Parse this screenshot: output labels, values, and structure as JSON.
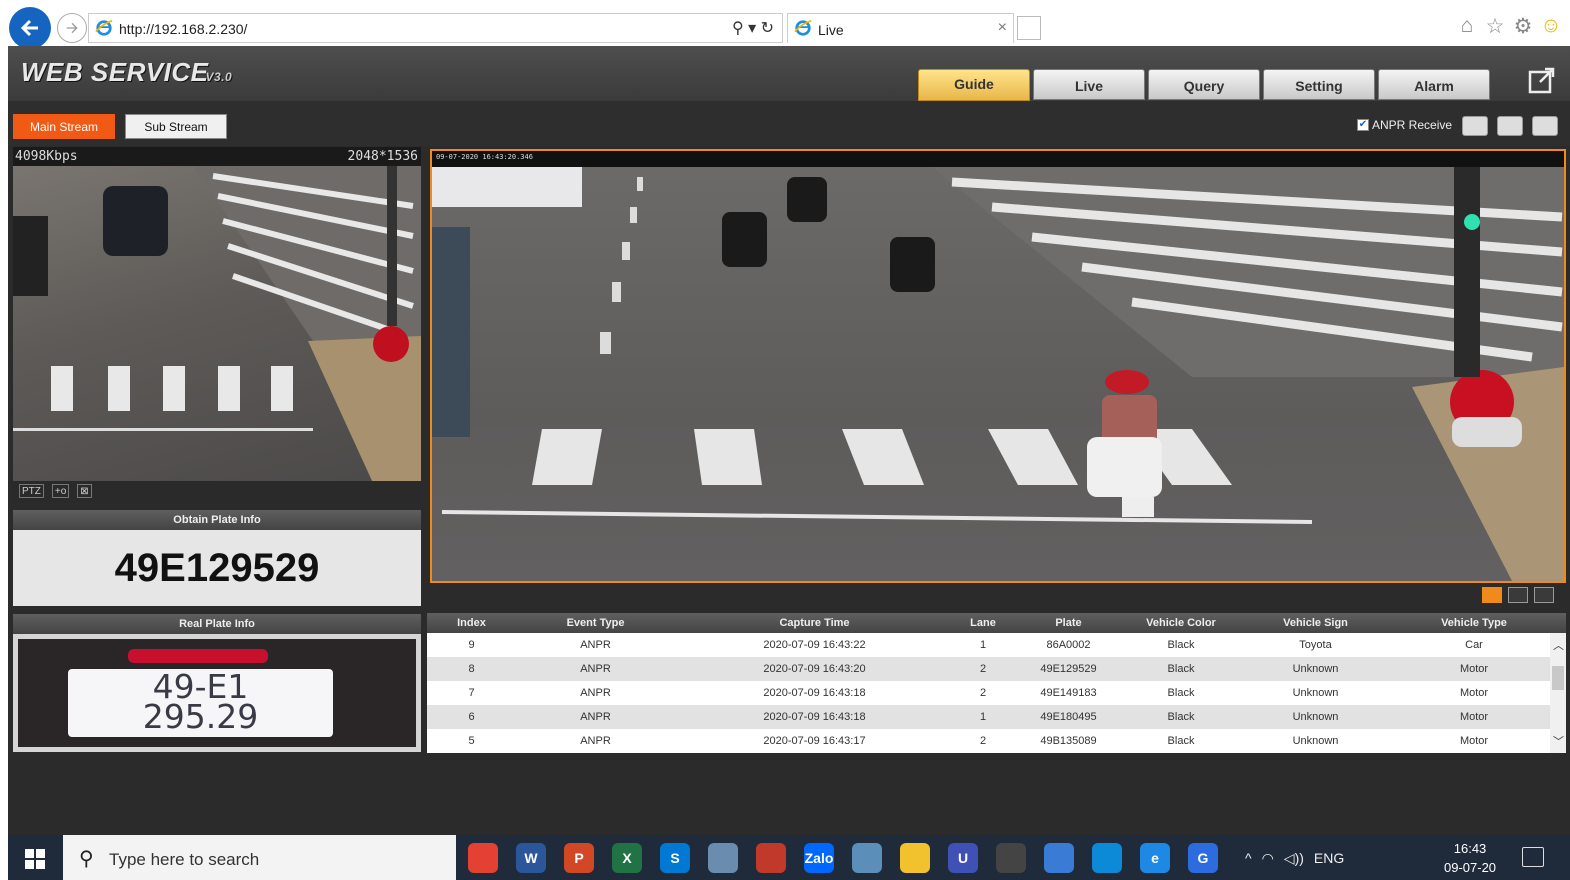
{
  "browser": {
    "url": "http://192.168.2.230/",
    "tab_title": "Live",
    "address_actions": "⚲ ▾ ↻",
    "tab_close": "×"
  },
  "app": {
    "logo": "WEB  SERVICE",
    "version": "V3.0",
    "tabs": [
      {
        "label": "Guide",
        "active": true
      },
      {
        "label": "Live",
        "active": false
      },
      {
        "label": "Query",
        "active": false
      },
      {
        "label": "Setting",
        "active": false
      },
      {
        "label": "Alarm",
        "active": false
      }
    ],
    "main_stream_label": "Main Stream",
    "sub_stream_label": "Sub Stream",
    "anpr_receive_label": "ANPR Receive",
    "anpr_receive_checked": true,
    "bitrate": "4098Kbps",
    "resolution": "2048*1536",
    "cam_tools": [
      "PTZ",
      "+o",
      "⊠"
    ],
    "main_timestamp": "09-07-2020 16:43:20.346",
    "obtain_plate_title": "Obtain Plate Info",
    "obtain_plate_value": "49E129529",
    "real_plate_title": "Real Plate Info",
    "real_plate_line1": "49-E1",
    "real_plate_line2": "295.29",
    "accent_color": "#f08a1a"
  },
  "table": {
    "headers": [
      "Index",
      "Event Type",
      "Capture Time",
      "Lane",
      "Plate",
      "Vehicle Color",
      "Vehicle Sign",
      "Vehicle Type"
    ],
    "rows": [
      [
        "9",
        "ANPR",
        "2020-07-09 16:43:22",
        "1",
        "86A0002",
        "Black",
        "Toyota",
        "Car"
      ],
      [
        "8",
        "ANPR",
        "2020-07-09 16:43:20",
        "2",
        "49E129529",
        "Black",
        "Unknown",
        "Motor"
      ],
      [
        "7",
        "ANPR",
        "2020-07-09 16:43:18",
        "2",
        "49E149183",
        "Black",
        "Unknown",
        "Motor"
      ],
      [
        "6",
        "ANPR",
        "2020-07-09 16:43:18",
        "1",
        "49E180495",
        "Black",
        "Unknown",
        "Motor"
      ],
      [
        "5",
        "ANPR",
        "2020-07-09 16:43:17",
        "2",
        "49B135089",
        "Black",
        "Unknown",
        "Motor"
      ]
    ]
  },
  "taskbar": {
    "search_placeholder": "Type here to search",
    "apps": [
      "chrome",
      "word",
      "powerpoint",
      "excel",
      "skype",
      "snipping",
      "paint",
      "zalo",
      "notes",
      "explorer",
      "ultraviewer",
      "terminal",
      "monitor",
      "edge",
      "internet-explorer",
      "foxit"
    ],
    "app_labels": [
      "",
      "W",
      "P",
      "X",
      "S",
      "",
      "",
      "Zalo",
      "",
      "",
      "U",
      "",
      "",
      "",
      "e",
      "G"
    ],
    "language": "ENG",
    "time": "16:43",
    "date": "09-07-20"
  }
}
